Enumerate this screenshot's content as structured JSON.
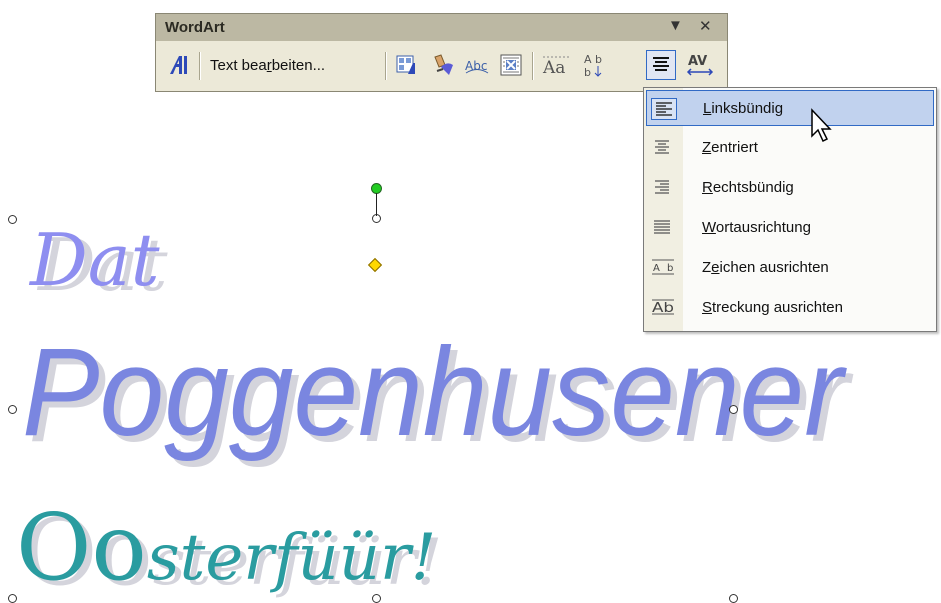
{
  "toolbar": {
    "title": "WordArt",
    "dropdown_glyph": "▼",
    "close_glyph": "✕",
    "edit_text_label_before": "Text bea",
    "edit_text_label_accel": "r",
    "edit_text_label_after": "beiten...",
    "icons": [
      "insert-wordart-icon",
      "wordart-gallery-icon",
      "format-wordart-icon",
      "wordart-shape-icon",
      "text-wrapping-icon",
      "same-letter-heights-icon",
      "vertical-text-icon",
      "alignment-icon",
      "character-spacing-icon"
    ]
  },
  "menu": {
    "items": [
      {
        "accel": "L",
        "rest": "inksbündig",
        "icon": "align-left-icon",
        "selected": true
      },
      {
        "accel": "Z",
        "rest": "entriert",
        "icon": "align-center-icon",
        "selected": false
      },
      {
        "accel": "R",
        "rest": "echtsbündig",
        "icon": "align-right-icon",
        "selected": false
      },
      {
        "accel": "W",
        "rest": "ortausrichtung",
        "icon": "word-justify-icon",
        "selected": false
      },
      {
        "pre": "Z",
        "accel": "e",
        "rest": "ichen ausrichten",
        "icon": "letter-justify-icon",
        "selected": false
      },
      {
        "accel": "S",
        "rest": "treckung ausrichten",
        "icon": "stretch-justify-icon",
        "selected": false
      }
    ]
  },
  "wordart": {
    "line1": "Dat",
    "line2": "Poggenhusener",
    "line3a": "Oo",
    "line3b": "sterfüür!",
    "colors": {
      "blue": "#8e8ef0",
      "blue_dark": "#6c7bd6",
      "teal": "#2a9ca0",
      "shadow": "#d4d4dc"
    }
  }
}
